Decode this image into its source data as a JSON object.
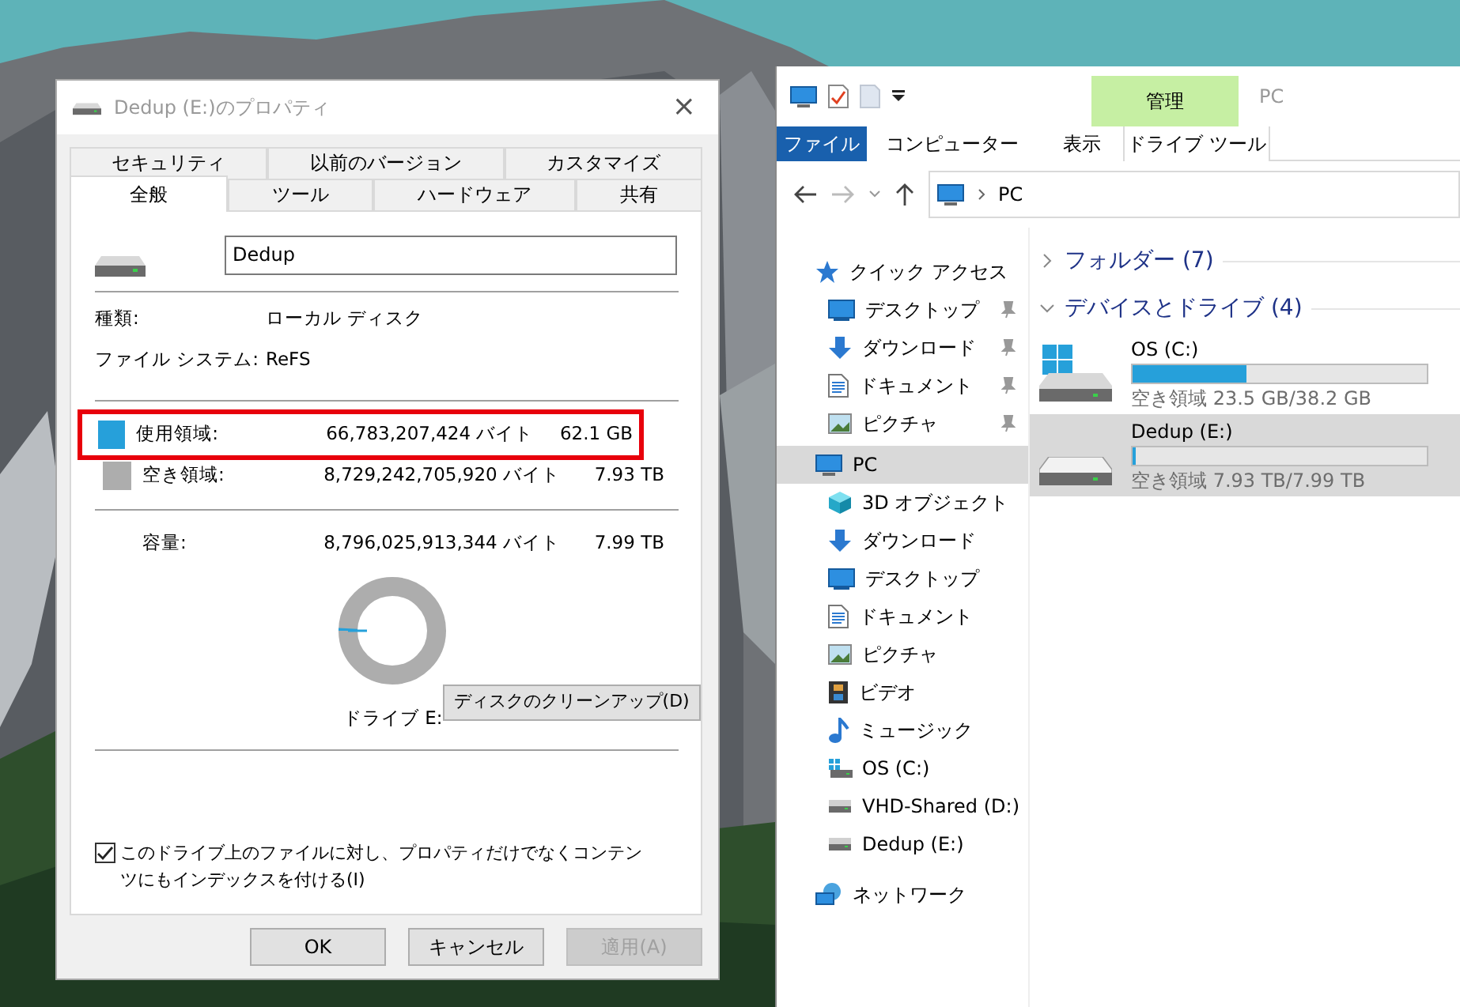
{
  "dialog": {
    "title": "Dedup (E:)のプロパティ",
    "close": "×",
    "tab_rows": [
      [
        {
          "label": "セキュリティ",
          "selected": false
        },
        {
          "label": "以前のバージョン",
          "selected": false
        },
        {
          "label": "カスタマイズ",
          "selected": false
        }
      ],
      [
        {
          "label": "全般",
          "selected": true
        },
        {
          "label": "ツール",
          "selected": false
        },
        {
          "label": "ハードウェア",
          "selected": false
        },
        {
          "label": "共有",
          "selected": false
        }
      ]
    ],
    "name_field": {
      "value": "Dedup"
    },
    "info": [
      {
        "label": "種類:",
        "value": "ローカル ディスク"
      },
      {
        "label": "ファイル システム:",
        "value": "ReFS"
      }
    ],
    "space": [
      {
        "label": "使用領域:",
        "bytes": "66,783,207,424 バイト",
        "size": "62.1 GB",
        "color": "#26a0da",
        "highlighted": true
      },
      {
        "label": "空き領域:",
        "bytes": "8,729,242,705,920 バイト",
        "size": "7.93 TB",
        "color": "#adadad",
        "highlighted": false
      }
    ],
    "capacity": {
      "label": "容量:",
      "bytes": "8,796,025,913,344 バイト",
      "size": "7.99 TB"
    },
    "donut": {
      "level": 0.008
    },
    "drive_label": "ドライブ E:",
    "cleanup_button": "ディスクのクリーンアップ(D)",
    "index_checkbox": {
      "label": "このドライブ上のファイルに対し、プロパティだけでなくコンテンツにもインデックスを付ける(I)",
      "checked": true
    },
    "buttons": [
      {
        "label": "OK",
        "disabled": false
      },
      {
        "label": "キャンセル",
        "disabled": false
      },
      {
        "label": "適用(A)",
        "disabled": true
      }
    ]
  },
  "explorer": {
    "title": "PC",
    "context_group": "管理",
    "ribbon_tabs": [
      {
        "label": "ファイル",
        "selected": true,
        "kind": "file"
      },
      {
        "label": "コンピューター",
        "selected": false,
        "kind": "tab"
      },
      {
        "label": "表示",
        "selected": false,
        "kind": "tab"
      },
      {
        "label": "ドライブ ツール",
        "selected": false,
        "kind": "context"
      }
    ],
    "address": "PC",
    "nav": [
      {
        "label": "クイック アクセス",
        "kind": "star",
        "selected": false,
        "children": [
          {
            "label": "デスクトップ",
            "kind": "desktop",
            "pinned": true,
            "selected": false
          },
          {
            "label": "ダウンロード",
            "kind": "download",
            "pinned": true,
            "selected": false
          },
          {
            "label": "ドキュメント",
            "kind": "document",
            "pinned": true,
            "selected": false
          },
          {
            "label": "ピクチャ",
            "kind": "pictures",
            "pinned": true,
            "selected": false
          }
        ]
      },
      {
        "label": "PC",
        "kind": "pc",
        "selected": true,
        "children": [
          {
            "label": "3D オブジェクト",
            "kind": "cube",
            "pinned": false,
            "selected": false
          },
          {
            "label": "ダウンロード",
            "kind": "download",
            "pinned": false,
            "selected": false
          },
          {
            "label": "デスクトップ",
            "kind": "desktop",
            "pinned": false,
            "selected": false
          },
          {
            "label": "ドキュメント",
            "kind": "document",
            "pinned": false,
            "selected": false
          },
          {
            "label": "ピクチャ",
            "kind": "pictures",
            "pinned": false,
            "selected": false
          },
          {
            "label": "ビデオ",
            "kind": "video",
            "pinned": false,
            "selected": false
          },
          {
            "label": "ミュージック",
            "kind": "music",
            "pinned": false,
            "selected": false
          },
          {
            "label": "OS (C:)",
            "kind": "windows-drive",
            "pinned": false,
            "selected": false
          },
          {
            "label": "VHD-Shared (D:)",
            "kind": "drive",
            "pinned": false,
            "selected": false
          },
          {
            "label": "Dedup (E:)",
            "kind": "drive",
            "pinned": false,
            "selected": false
          }
        ]
      },
      {
        "label": "ネットワーク",
        "kind": "network",
        "selected": false
      }
    ],
    "groups": [
      {
        "label": "フォルダー (7)",
        "expanded": false
      },
      {
        "label": "デバイスとドライブ (4)",
        "expanded": true,
        "drives": [
          {
            "name": "OS (C:)",
            "free": "空き領域 23.5 GB/38.2 GB",
            "level": 0.385,
            "kind": "windows-drive",
            "selected": false
          },
          {
            "name": "Dedup (E:)",
            "free": "空き領域 7.93 TB/7.99 TB",
            "level": 0.008,
            "kind": "drive",
            "selected": true
          }
        ]
      }
    ]
  }
}
